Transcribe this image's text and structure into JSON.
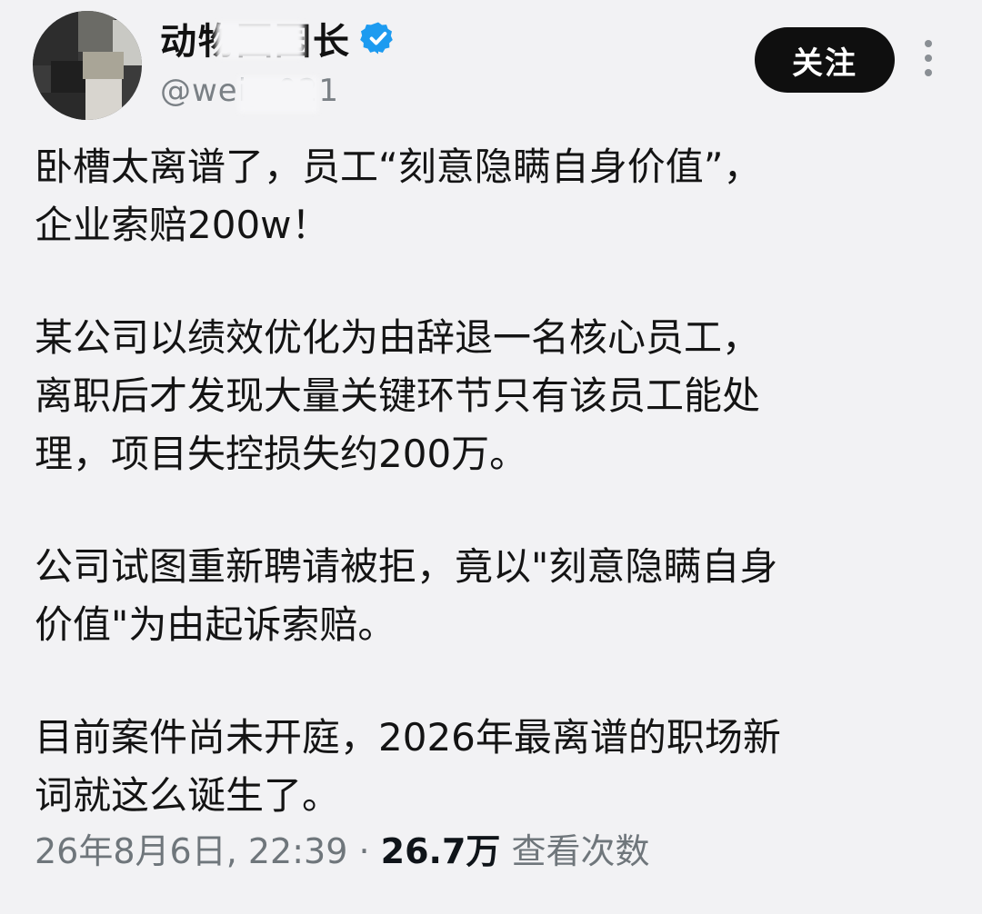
{
  "profile": {
    "display_name": "动物园园长",
    "handle": "@weiy  021",
    "verified": true
  },
  "follow_button": {
    "label": "关注"
  },
  "more_icon": "vertical-ellipsis-icon",
  "post": {
    "line1": "卧槽太离谱了，员工“刻意隐瞒自身价值”，",
    "line2": "企业索赔200w！",
    "line3": "某公司以绩效优化为由辞退一名核心员工，",
    "line4": "离职后才发现大量关键环节只有该员工能处",
    "line5": "理，项目失控损失约200万。",
    "line6": "公司试图重新聘请被拒，竟以\"刻意隐瞒自身",
    "line7": "价值\"为由起诉索赔。",
    "line8": "目前案件尚未开庭，2026年最离谱的职场新",
    "line9": "词就这么诞生了。"
  },
  "meta": {
    "timestamp": "26年8月6日, 22:39",
    "separator": " · ",
    "views_count": "26.7万",
    "views_label": " 查看次数"
  },
  "colors": {
    "background": "#f2f2f4",
    "verified_badge": "#1d9bf0",
    "follow_button_bg": "#0f0f0f"
  }
}
